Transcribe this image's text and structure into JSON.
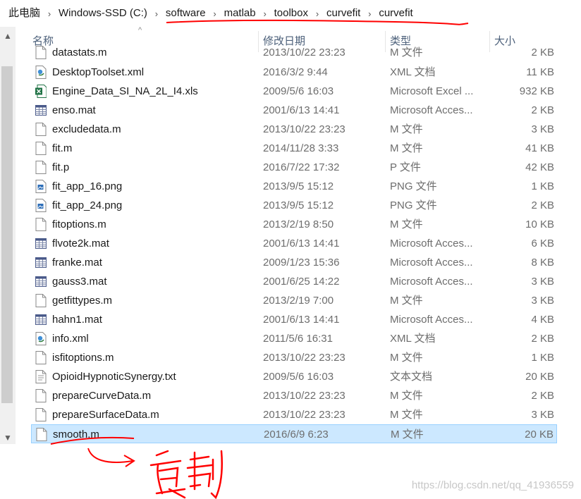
{
  "address_bar": {
    "crumbs": [
      "此电脑",
      "Windows-SSD (C:)",
      "software",
      "matlab",
      "toolbox",
      "curvefit",
      "curvefit"
    ],
    "separator": "›"
  },
  "columns": {
    "name": "名称",
    "date": "修改日期",
    "type": "类型",
    "size": "大小",
    "sort_indicator": "^"
  },
  "scrollbar": {
    "up": "▲",
    "down": "▼"
  },
  "files": [
    {
      "name": "datastats.m",
      "date": "2013/10/22 23:23",
      "type": "M 文件",
      "size": "2 KB",
      "icon": "m-file-icon"
    },
    {
      "name": "DesktopToolset.xml",
      "date": "2016/3/2 9:44",
      "type": "XML 文档",
      "size": "11 KB",
      "icon": "xml-file-icon"
    },
    {
      "name": "Engine_Data_SI_NA_2L_I4.xls",
      "date": "2009/5/6 16:03",
      "type": "Microsoft Excel ...",
      "size": "932 KB",
      "icon": "excel-file-icon"
    },
    {
      "name": "enso.mat",
      "date": "2001/6/13 14:41",
      "type": "Microsoft Acces...",
      "size": "2 KB",
      "icon": "mat-file-icon"
    },
    {
      "name": "excludedata.m",
      "date": "2013/10/22 23:23",
      "type": "M 文件",
      "size": "3 KB",
      "icon": "m-file-icon"
    },
    {
      "name": "fit.m",
      "date": "2014/11/28 3:33",
      "type": "M 文件",
      "size": "41 KB",
      "icon": "m-file-icon"
    },
    {
      "name": "fit.p",
      "date": "2016/7/22 17:32",
      "type": "P 文件",
      "size": "42 KB",
      "icon": "p-file-icon"
    },
    {
      "name": "fit_app_16.png",
      "date": "2013/9/5 15:12",
      "type": "PNG 文件",
      "size": "1 KB",
      "icon": "png-file-icon"
    },
    {
      "name": "fit_app_24.png",
      "date": "2013/9/5 15:12",
      "type": "PNG 文件",
      "size": "2 KB",
      "icon": "png-file-icon"
    },
    {
      "name": "fitoptions.m",
      "date": "2013/2/19 8:50",
      "type": "M 文件",
      "size": "10 KB",
      "icon": "m-file-icon"
    },
    {
      "name": "flvote2k.mat",
      "date": "2001/6/13 14:41",
      "type": "Microsoft Acces...",
      "size": "6 KB",
      "icon": "mat-file-icon"
    },
    {
      "name": "franke.mat",
      "date": "2009/1/23 15:36",
      "type": "Microsoft Acces...",
      "size": "8 KB",
      "icon": "mat-file-icon"
    },
    {
      "name": "gauss3.mat",
      "date": "2001/6/25 14:22",
      "type": "Microsoft Acces...",
      "size": "3 KB",
      "icon": "mat-file-icon"
    },
    {
      "name": "getfittypes.m",
      "date": "2013/2/19 7:00",
      "type": "M 文件",
      "size": "3 KB",
      "icon": "m-file-icon"
    },
    {
      "name": "hahn1.mat",
      "date": "2001/6/13 14:41",
      "type": "Microsoft Acces...",
      "size": "4 KB",
      "icon": "mat-file-icon"
    },
    {
      "name": "info.xml",
      "date": "2011/5/6 16:31",
      "type": "XML 文档",
      "size": "2 KB",
      "icon": "xml-file-icon"
    },
    {
      "name": "isfitoptions.m",
      "date": "2013/10/22 23:23",
      "type": "M 文件",
      "size": "1 KB",
      "icon": "m-file-icon"
    },
    {
      "name": "OpioidHypnoticSynergy.txt",
      "date": "2009/5/6 16:03",
      "type": "文本文档",
      "size": "20 KB",
      "icon": "txt-file-icon"
    },
    {
      "name": "prepareCurveData.m",
      "date": "2013/10/22 23:23",
      "type": "M 文件",
      "size": "2 KB",
      "icon": "m-file-icon"
    },
    {
      "name": "prepareSurfaceData.m",
      "date": "2013/10/22 23:23",
      "type": "M 文件",
      "size": "3 KB",
      "icon": "m-file-icon"
    },
    {
      "name": "smooth.m",
      "date": "2016/6/9 6:23",
      "type": "M 文件",
      "size": "20 KB",
      "icon": "m-file-icon",
      "selected": true
    }
  ],
  "annotation": {
    "text": "复制",
    "color": "#ff0000"
  },
  "watermark": "https://blog.csdn.net/qq_41936559",
  "colors": {
    "selection_bg": "#cce8ff",
    "selection_border": "#99d1ff",
    "header_text": "#4c607a",
    "meta_text": "#6d6d6d"
  }
}
